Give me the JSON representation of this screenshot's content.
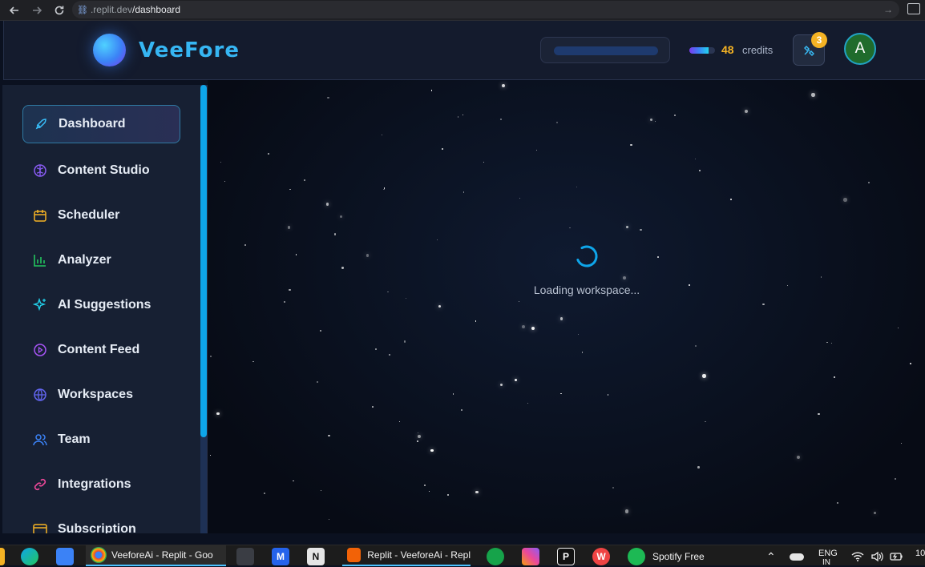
{
  "browser": {
    "url_host": ".replit.dev",
    "url_path": "/dashboard"
  },
  "header": {
    "brand": "VeeFore",
    "credits_value": "48",
    "credits_label": "credits",
    "credits_fraction": 0.75,
    "notification_count": "3",
    "avatar_initial": "A"
  },
  "sidebar": {
    "items": [
      {
        "label": "Dashboard",
        "icon": "rocket-icon",
        "active": true
      },
      {
        "label": "Content Studio",
        "icon": "brain-icon"
      },
      {
        "label": "Scheduler",
        "icon": "calendar-icon"
      },
      {
        "label": "Analyzer",
        "icon": "bar-chart-icon"
      },
      {
        "label": "AI Suggestions",
        "icon": "sparkles-icon"
      },
      {
        "label": "Content Feed",
        "icon": "play-circle-icon"
      },
      {
        "label": "Workspaces",
        "icon": "globe-icon"
      },
      {
        "label": "Team",
        "icon": "users-icon"
      },
      {
        "label": "Integrations",
        "icon": "link-icon"
      },
      {
        "label": "Subscription",
        "icon": "credit-card-icon"
      }
    ]
  },
  "main": {
    "loading_text": "Loading workspace..."
  },
  "taskbar": {
    "chrome_window": "VeeforeAi - Replit - Goo",
    "replit_window": "Replit - VeeforeAi - Repl",
    "spotify": "Spotify Free",
    "lang_top": "ENG",
    "lang_bottom": "IN",
    "clock_top": "10"
  },
  "colors": {
    "accent": "#0ea5e9",
    "credits": "#f5b324",
    "brand": "#36b6f3"
  }
}
